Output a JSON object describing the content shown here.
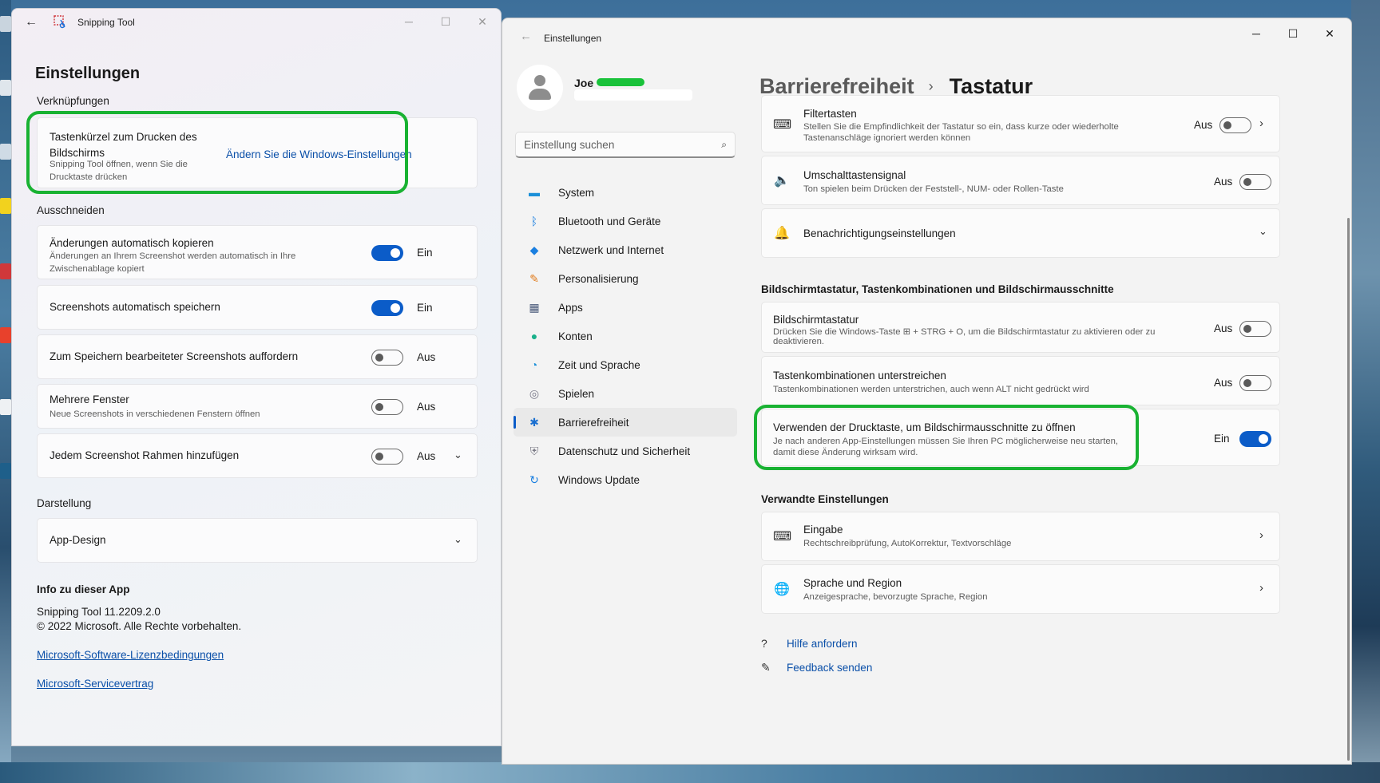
{
  "snipping_tool": {
    "window_title": "Snipping Tool",
    "page_title": "Einstellungen",
    "shortcuts_section": "Verknüpfungen",
    "printscreen_title": "Tastenkürzel zum Drucken des Bildschirms",
    "printscreen_desc": "Snipping Tool öffnen, wenn Sie die Drucktaste drücken",
    "printscreen_link": "Ändern Sie die Windows-Einstellungen",
    "snip_section": "Ausschneiden",
    "auto_copy_title": "Änderungen automatisch kopieren",
    "auto_copy_desc": "Änderungen an Ihrem Screenshot werden automatisch in Ihre Zwischenablage kopiert",
    "auto_copy_state": "Ein",
    "auto_save_title": "Screenshots automatisch speichern",
    "auto_save_state": "Ein",
    "ask_save_title": "Zum Speichern bearbeiteter Screenshots auffordern",
    "ask_save_state": "Aus",
    "multi_window_title": "Mehrere Fenster",
    "multi_window_desc": "Neue Screenshots in verschiedenen Fenstern öffnen",
    "multi_window_state": "Aus",
    "border_title": "Jedem Screenshot Rahmen hinzufügen",
    "border_state": "Aus",
    "appearance_section": "Darstellung",
    "app_design": "App-Design",
    "about_section": "Info zu dieser App",
    "version": "Snipping Tool 11.2209.2.0",
    "copyright": "© 2022 Microsoft. Alle Rechte vorbehalten.",
    "license_link": "Microsoft-Software-Lizenzbedingungen",
    "service_link": "Microsoft-Servicevertrag"
  },
  "settings": {
    "window_title": "Einstellungen",
    "user_name": "Joe",
    "search_placeholder": "Einstellung suchen",
    "nav": [
      {
        "label": "System",
        "icon": "monitor-icon",
        "color": "#1a8fd8"
      },
      {
        "label": "Bluetooth und Geräte",
        "icon": "bluetooth-icon",
        "color": "#1a7fe0"
      },
      {
        "label": "Netzwerk und Internet",
        "icon": "wifi-icon",
        "color": "#1a7fe0"
      },
      {
        "label": "Personalisierung",
        "icon": "brush-icon",
        "color": "#e07a1a"
      },
      {
        "label": "Apps",
        "icon": "apps-icon",
        "color": "#4a5a7a"
      },
      {
        "label": "Konten",
        "icon": "account-icon",
        "color": "#1ab08a"
      },
      {
        "label": "Zeit und Sprache",
        "icon": "globe-clock-icon",
        "color": "#1a8fd8"
      },
      {
        "label": "Spielen",
        "icon": "gamepad-icon",
        "color": "#7a7a8a"
      },
      {
        "label": "Barrierefreiheit",
        "icon": "accessibility-icon",
        "color": "#1a6fd0"
      },
      {
        "label": "Datenschutz und Sicherheit",
        "icon": "shield-icon",
        "color": "#7a7a86"
      },
      {
        "label": "Windows Update",
        "icon": "update-icon",
        "color": "#1a7fe0"
      }
    ],
    "active_nav": "Barrierefreiheit",
    "breadcrumb_parent": "Barrierefreiheit",
    "breadcrumb_current": "Tastatur",
    "filter_keys_title": "Filtertasten",
    "filter_keys_desc": "Stellen Sie die Empfindlichkeit der Tastatur so ein, dass kurze oder wiederholte Tastenanschläge ignoriert werden können",
    "filter_keys_state": "Aus",
    "toggle_keys_title": "Umschalttastensignal",
    "toggle_keys_desc": "Ton spielen beim Drücken der Feststell-, NUM- oder Rollen-Taste",
    "toggle_keys_state": "Aus",
    "notif_title": "Benachrichtigungseinstellungen",
    "osk_section": "Bildschirmtastatur, Tastenkombinationen und Bildschirmausschnitte",
    "osk_title": "Bildschirmtastatur",
    "osk_desc": "Drücken Sie die Windows-Taste ⊞ + STRG + O, um die Bildschirmtastatur zu aktivieren oder zu deaktivieren.",
    "osk_state": "Aus",
    "underline_title": "Tastenkombinationen unterstreichen",
    "underline_desc": "Tastenkombinationen werden unterstrichen, auch wenn ALT nicht gedrückt wird",
    "underline_state": "Aus",
    "printscreen_title": "Verwenden der Drucktaste, um Bildschirmausschnitte zu öffnen",
    "printscreen_desc": "Je nach anderen App-Einstellungen müssen Sie Ihren PC möglicherweise neu starten, damit diese Änderung wirksam wird.",
    "printscreen_state": "Ein",
    "related_section": "Verwandte Einstellungen",
    "input_title": "Eingabe",
    "input_desc": "Rechtschreibprüfung, AutoKorrektur, Textvorschläge",
    "lang_title": "Sprache und Region",
    "lang_desc": "Anzeigesprache, bevorzugte Sprache, Region",
    "help_link": "Hilfe anfordern",
    "feedback_link": "Feedback senden"
  },
  "colors": {
    "accent": "#0b5cc8",
    "highlight_outline": "#19b232",
    "link": "#0a4fa8"
  }
}
